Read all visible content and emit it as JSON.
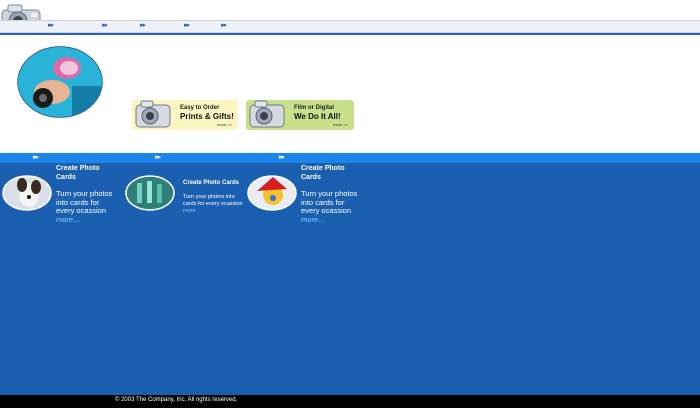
{
  "promos": [
    {
      "line1": "Easy to Order",
      "line2": "Prints & Gifts!",
      "more": "more >>"
    },
    {
      "line1": "Film or Digital",
      "line2": "We Do It All!",
      "more": "more >>"
    }
  ],
  "cards": [
    {
      "title": "Create Photo Cards",
      "body": "Turn your photos into cards for every ocassion",
      "more": "more..."
    },
    {
      "title": "Create Photo Cards",
      "body": "Turn your photos into cards for every ocassion",
      "more": "more"
    },
    {
      "title": "Create Photo Cards",
      "body": "Turn your photos into cards for every ocassion",
      "more": "more..."
    }
  ],
  "footer": {
    "copyright": "© 2003 The Company, Inc. All rights reserved."
  },
  "icons": {
    "nav_arrow": "double-arrow-icon",
    "logo": "camera-icon"
  },
  "colors": {
    "page_bg": "#1a5fb0",
    "accent_bar": "#1c85ea",
    "nav_line": "#2a62c4"
  }
}
